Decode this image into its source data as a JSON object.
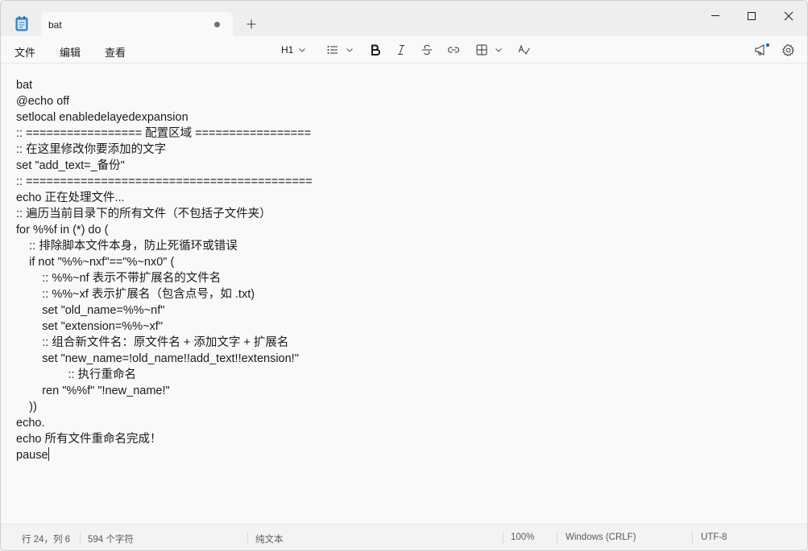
{
  "titlebar": {
    "tab_title": "bat",
    "new_tab_symbol": "+",
    "icons": [
      "notepad-icon",
      "unsaved-dot-icon",
      "plus-icon",
      "minimize-icon",
      "maximize-icon",
      "close-icon"
    ]
  },
  "menu": {
    "file": "文件",
    "edit": "编辑",
    "view": "查看"
  },
  "format_toolbar": {
    "heading_label": "H1",
    "icons": [
      "list-icon",
      "bold-icon",
      "italic-icon",
      "strikethrough-icon",
      "link-icon",
      "table-icon",
      "clear-format-icon",
      "announcement-icon",
      "gear-icon"
    ]
  },
  "document": {
    "lines": [
      "bat",
      "@echo off",
      "setlocal enabledelayedexpansion",
      ":: ================= 配置区域 =================",
      ":: 在这里修改你要添加的文字",
      "set \"add_text=_备份\"",
      ":: ==========================================",
      "echo 正在处理文件...",
      ":: 遍历当前目录下的所有文件（不包括子文件夹）",
      "for %%f in (*) do (",
      "    :: 排除脚本文件本身，防止死循环或错误",
      "    if not \"%%~nxf\"==\"%~nx0\" (",
      "        :: %%~nf 表示不带扩展名的文件名",
      "        :: %%~xf 表示扩展名（包含点号，如 .txt)",
      "        set \"old_name=%%~nf\"",
      "        set \"extension=%%~xf\"",
      "        :: 组合新文件名：原文件名 + 添加文字 + 扩展名",
      "        set \"new_name=!old_name!!add_text!!extension!\"",
      "                :: 执行重命名",
      "        ren \"%%f\" \"!new_name!\"",
      "    ))",
      "echo.",
      "echo 所有文件重命名完成！",
      "pause"
    ]
  },
  "statusbar": {
    "position": "行 24，列 6",
    "char_count": "594 个字符",
    "format": "纯文本",
    "zoom": "100%",
    "line_ending": "Windows (CRLF)",
    "encoding": "UTF-8"
  },
  "colors": {
    "accent": "#0067c0",
    "background": "#f9f9f9",
    "titlebar": "#eeeeee",
    "text": "#1b1b1b"
  }
}
